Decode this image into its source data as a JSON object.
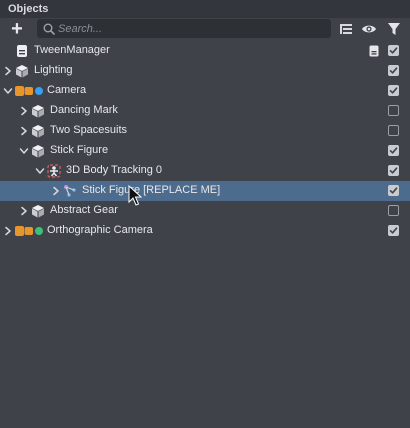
{
  "panel": {
    "title": "Objects"
  },
  "toolbar": {
    "add_icon": "plus-icon",
    "search_placeholder": "Search...",
    "search_value": "",
    "hierarchy_icon": "hierarchy-icon",
    "visibility_icon": "eye-icon",
    "filter_icon": "filter-icon"
  },
  "tree": [
    {
      "label": "TweenManager",
      "depth": 0,
      "expander": "none",
      "icon": "script-icon",
      "extra_icon": "document-icon",
      "checked": true,
      "selected": false
    },
    {
      "label": "Lighting",
      "depth": 0,
      "expander": "collapsed",
      "icon": "cube-icon",
      "checked": true,
      "selected": false
    },
    {
      "label": "Camera",
      "depth": 0,
      "expander": "expanded",
      "icon": "camera-icon",
      "dot_color": "#3aa0f0",
      "checked": true,
      "selected": false
    },
    {
      "label": "Dancing Mark",
      "depth": 1,
      "expander": "collapsed",
      "icon": "cube-icon",
      "checked": false,
      "selected": false
    },
    {
      "label": "Two Spacesuits",
      "depth": 1,
      "expander": "collapsed",
      "icon": "cube-icon",
      "checked": false,
      "selected": false
    },
    {
      "label": "Stick Figure",
      "depth": 1,
      "expander": "expanded",
      "icon": "cube-icon",
      "checked": true,
      "selected": false
    },
    {
      "label": "3D Body Tracking 0",
      "depth": 2,
      "expander": "expanded",
      "icon": "body-tracking-icon",
      "checked": true,
      "selected": false
    },
    {
      "label": "Stick Figure [REPLACE ME]",
      "depth": 3,
      "expander": "collapsed",
      "icon": "skeleton-icon",
      "checked": true,
      "selected": true
    },
    {
      "label": "Abstract Gear",
      "depth": 1,
      "expander": "collapsed",
      "icon": "cube-icon",
      "checked": false,
      "selected": false
    },
    {
      "label": "Orthographic Camera",
      "depth": 0,
      "expander": "collapsed",
      "icon": "camera-icon",
      "dot_color": "#3ec07a",
      "checked": true,
      "selected": false
    }
  ],
  "colors": {
    "background": "#3f4249",
    "selection": "#4d6b8c",
    "camera_orange": "#e8962c"
  }
}
